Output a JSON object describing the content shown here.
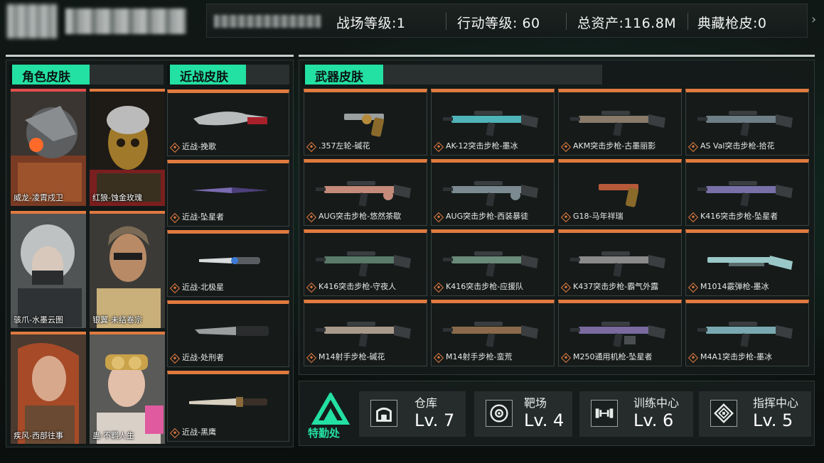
{
  "colors": {
    "accent": "#23e0a3",
    "rarity_orange": "#e07a3f",
    "rarity_red": "#e04e4e",
    "panel_bg": "#141a19"
  },
  "header": {
    "stats": [
      {
        "label": "战场等级:",
        "value": "1"
      },
      {
        "label": "行动等级:",
        "value": "60"
      },
      {
        "label": "总资产:",
        "value": "116.8M"
      },
      {
        "label": "典藏枪皮:",
        "value": "0"
      }
    ]
  },
  "character_skins": {
    "title": "角色皮肤",
    "items": [
      {
        "label": "威龙-凌霄戍卫",
        "icon": "character-portrait"
      },
      {
        "label": "红狼-蚀金玫瑰",
        "icon": "character-portrait"
      },
      {
        "label": "骇爪-水墨云图",
        "icon": "character-portrait"
      },
      {
        "label": "银翼-未结卷宗",
        "icon": "character-portrait"
      },
      {
        "label": "疾风-西部往事",
        "icon": "character-portrait"
      },
      {
        "label": "蛊-不羁人生",
        "icon": "character-portrait"
      }
    ]
  },
  "melee_skins": {
    "title": "近战皮肤",
    "items": [
      {
        "label": "近战-挽歌",
        "icon": "kukri-knife-icon"
      },
      {
        "label": "近战-坠星者",
        "icon": "throwing-knife-icon"
      },
      {
        "label": "近战-北极星",
        "icon": "dagger-icon"
      },
      {
        "label": "近战-处刑者",
        "icon": "combat-knife-icon"
      },
      {
        "label": "近战-黑鹰",
        "icon": "bayonet-icon"
      }
    ]
  },
  "weapon_skins": {
    "title": "武器皮肤",
    "items": [
      {
        "label": ".357左轮-碱花",
        "icon": "revolver-icon"
      },
      {
        "label": "AK-12突击步枪-墨冰",
        "icon": "rifle-icon"
      },
      {
        "label": "AKM突击步枪-古墨丽影",
        "icon": "rifle-icon"
      },
      {
        "label": "AS Val突击步枪-拾花",
        "icon": "rifle-icon"
      },
      {
        "label": "AUG突击步枪-悠然茶歇",
        "icon": "bullpup-rifle-icon"
      },
      {
        "label": "AUG突击步枪-西装暴徒",
        "icon": "bullpup-rifle-icon"
      },
      {
        "label": "G18-马年祥瑞",
        "icon": "pistol-icon"
      },
      {
        "label": "K416突击步枪-坠星者",
        "icon": "rifle-icon"
      },
      {
        "label": "K416突击步枪-守夜人",
        "icon": "rifle-icon"
      },
      {
        "label": "K416突击步枪-应援队",
        "icon": "rifle-icon"
      },
      {
        "label": "K437突击步枪-霸气外露",
        "icon": "rifle-icon"
      },
      {
        "label": "M1014霰弹枪-墨冰",
        "icon": "shotgun-icon"
      },
      {
        "label": "M14射手步枪-碱花",
        "icon": "marksman-rifle-icon"
      },
      {
        "label": "M14射手步枪-蛮荒",
        "icon": "marksman-rifle-icon"
      },
      {
        "label": "M250通用机枪-坠星者",
        "icon": "machine-gun-icon"
      },
      {
        "label": "M4A1突击步枪-墨冰",
        "icon": "rifle-icon"
      }
    ]
  },
  "logistics": {
    "label": "特勤处",
    "facilities": [
      {
        "name": "仓库",
        "level": "Lv. 7",
        "icon": "warehouse-icon"
      },
      {
        "name": "靶场",
        "level": "Lv. 4",
        "icon": "target-icon"
      },
      {
        "name": "训练中心",
        "level": "Lv. 6",
        "icon": "dumbbell-icon"
      },
      {
        "name": "指挥中心",
        "level": "Lv. 5",
        "icon": "command-chip-icon"
      }
    ]
  }
}
